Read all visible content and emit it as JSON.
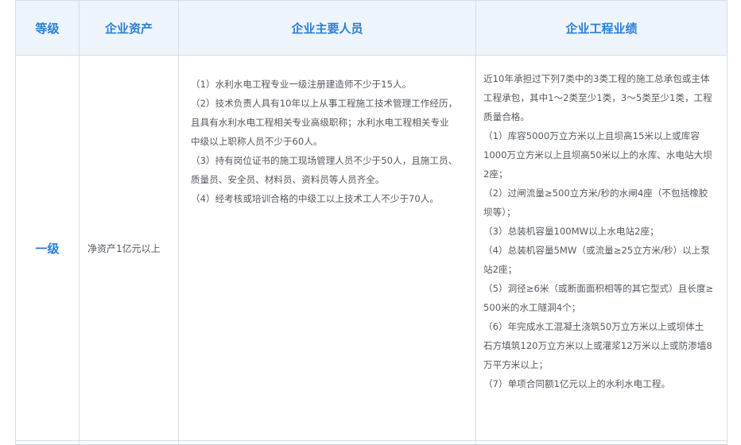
{
  "headers": {
    "grade": "等级",
    "assets": "企业资产",
    "staff": "企业主要人员",
    "performance": "企业工程业绩"
  },
  "row": {
    "grade": "一级",
    "assets": "净资产1亿元以上",
    "staff_lines": [
      "（1）水利水电工程专业一级注册建造师不少于15人。",
      "（2）技术负责人具有10年以上从事工程施工技术管理工作经历，",
      "且具有水利水电工程相关专业高级职称；水利水电工程相关专业",
      "中级以上职称人员不少于60人。",
      "（3）持有岗位证书的施工现场管理人员不少于50人，且施工员、",
      "质量员、安全员、材料员、资料员等人员齐全。",
      "（4）经考核或培训合格的中级工以上技术工人不少于70人。"
    ],
    "performance_lines": [
      "近10年承担过下列7类中的3类工程的施工总承包或主体",
      "工程承包，其中1～2类至少1类，3～5类至少1类，工程",
      "质量合格。",
      "（1）库容5000万立方米以上且坝高15米以上或库容",
      "1000万立方米以上且坝高50米以上的水库、水电站大坝",
      "2座；",
      "（2）过闸流量≥500立方米/秒的水闸4座（不包括橡胶",
      "坝等）；",
      "（3）总装机容量100MW以上水电站2座；",
      "（4）总装机容量5MW（或流量≥25立方米/秒）以上泵",
      "站2座；",
      "（5）洞径≥6米（或断面面积相等的其它型式）且长度≥",
      "500米的水工隧洞4个；",
      "（6）年完成水工混凝土浇筑50万立方米以上或坝体土",
      "石方填筑120万立方米以上或灌浆12万米以上或防渗墙8",
      "万平方米以上；",
      "（7）单项合同额1亿元以上的水利水电工程。"
    ]
  }
}
